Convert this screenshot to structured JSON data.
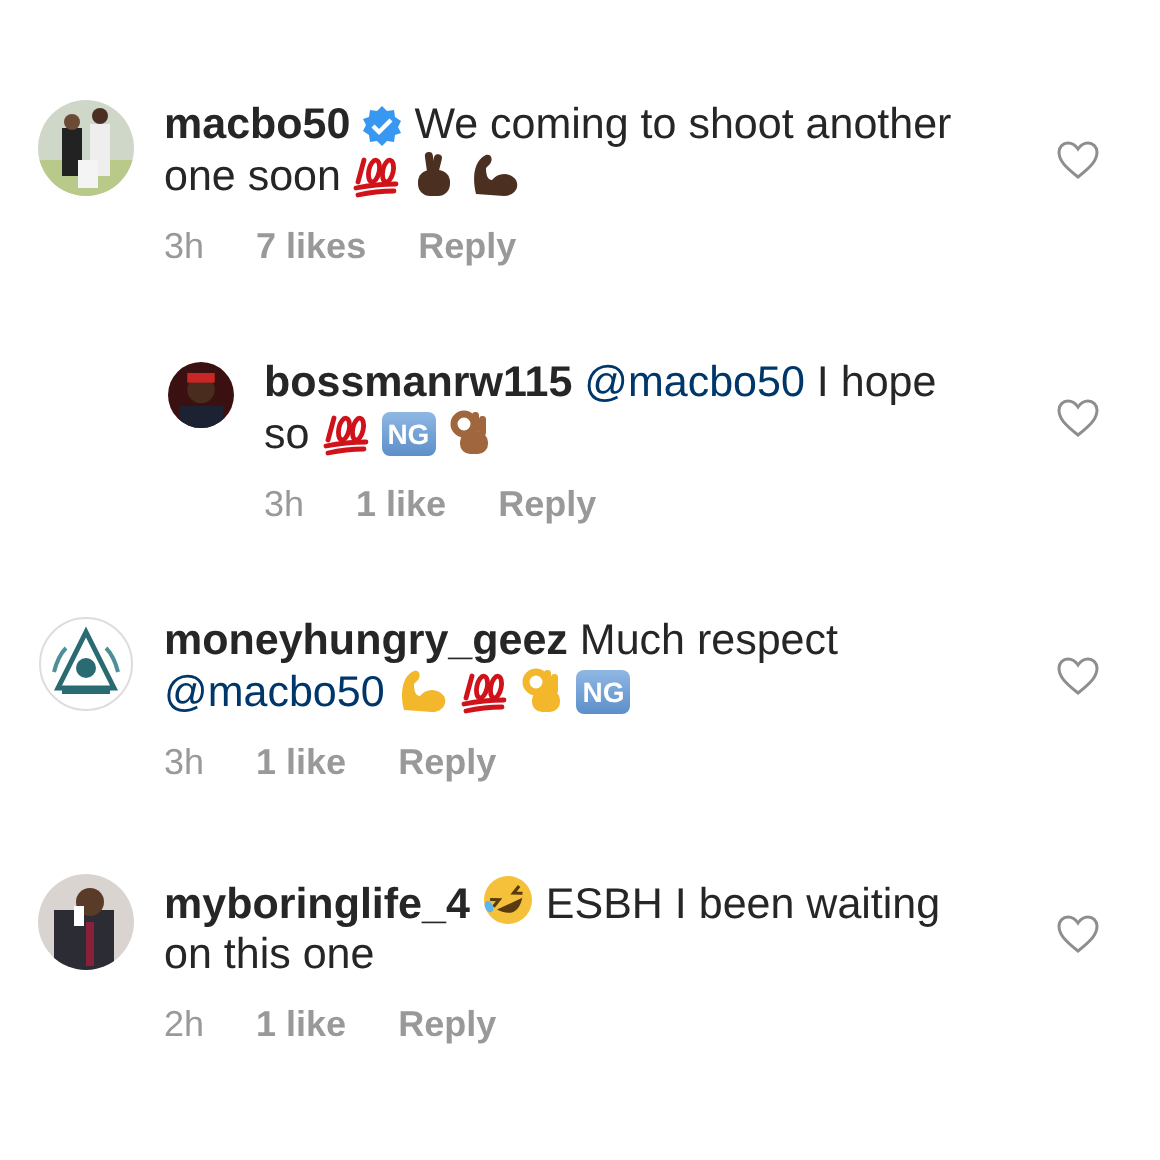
{
  "comments": [
    {
      "username": "macbo50",
      "verified": true,
      "lines": [
        [
          {
            "kind": "text",
            "text": "We coming to shoot another"
          }
        ],
        [
          {
            "kind": "text",
            "text": "one soon"
          },
          {
            "kind": "hundred"
          },
          {
            "kind": "crossed_fingers",
            "color": "#4b3022"
          },
          {
            "kind": "biceps",
            "color": "#4b3022"
          }
        ]
      ],
      "time": "3h",
      "likes": "7 likes",
      "reply": "Reply",
      "liked": false,
      "children": [
        {
          "username": "bossmanrw115",
          "verified": false,
          "lines": [
            [
              {
                "kind": "mention",
                "text": "@macbo50"
              },
              {
                "kind": "text",
                "text": "I hope"
              }
            ],
            [
              {
                "kind": "text",
                "text": "so"
              },
              {
                "kind": "hundred"
              },
              {
                "kind": "ng",
                "text": "NG"
              },
              {
                "kind": "ok_hand",
                "color": "#a0673f"
              }
            ]
          ],
          "time": "3h",
          "likes": "1 like",
          "reply": "Reply",
          "liked": false
        }
      ]
    },
    {
      "username": "moneyhungry_geez",
      "verified": false,
      "lines": [
        [
          {
            "kind": "text",
            "text": "Much respect"
          }
        ],
        [
          {
            "kind": "mention",
            "text": "@macbo50"
          },
          {
            "kind": "biceps",
            "color": "#f2b72a"
          },
          {
            "kind": "hundred"
          },
          {
            "kind": "ok_hand",
            "color": "#f2b72a"
          },
          {
            "kind": "ng",
            "text": "NG"
          }
        ]
      ],
      "time": "3h",
      "likes": "1 like",
      "reply": "Reply",
      "liked": false
    },
    {
      "username": "myboringlife_4",
      "verified": false,
      "lines": [
        [
          {
            "kind": "rofl"
          },
          {
            "kind": "text",
            "text": "ESBH I been waiting"
          }
        ],
        [
          {
            "kind": "text",
            "text": "on this one"
          }
        ]
      ],
      "time": "2h",
      "likes": "1 like",
      "reply": "Reply",
      "liked": false
    }
  ]
}
